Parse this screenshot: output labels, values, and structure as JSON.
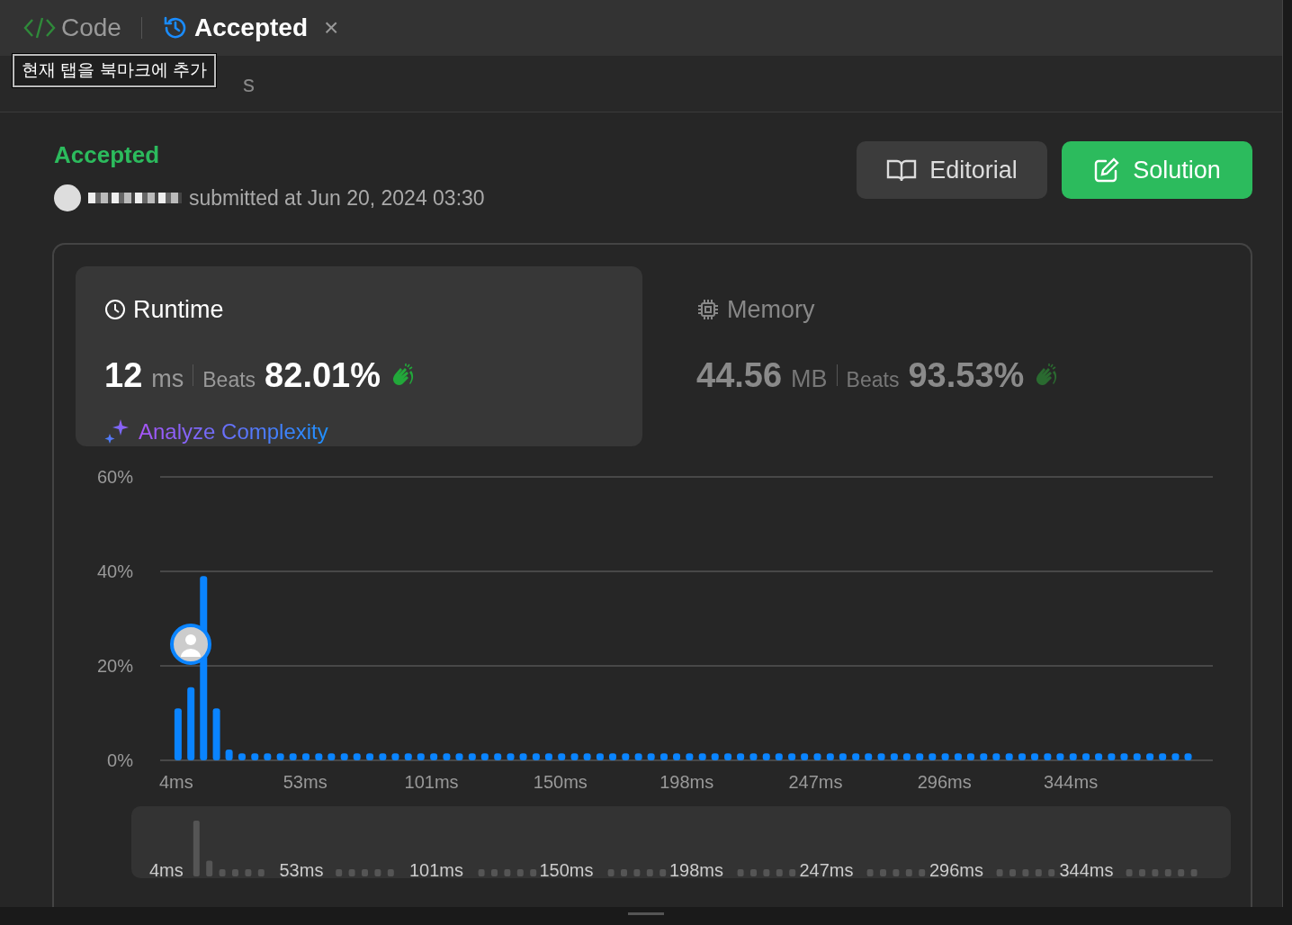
{
  "tabs": [
    {
      "kind": "code",
      "label": "Code",
      "selected": false,
      "closable": false
    },
    {
      "kind": "history",
      "label": "Accepted",
      "selected": true,
      "closable": true,
      "close_label": "×"
    }
  ],
  "tooltip": "현재 탭을 북마크에 추가",
  "back_link": "s",
  "result": {
    "status": "Accepted",
    "submitted": "submitted at Jun 20, 2024 03:30"
  },
  "actions": [
    {
      "kind": "editorial",
      "label": "Editorial"
    },
    {
      "kind": "solution",
      "label": "Solution"
    }
  ],
  "metrics": [
    {
      "kind": "runtime",
      "title": "Runtime",
      "value": "12",
      "unit": "ms",
      "beats_label": "Beats",
      "beats": "82.01%",
      "selected": true,
      "link": "Analyze Complexity"
    },
    {
      "kind": "memory",
      "title": "Memory",
      "value": "44.56",
      "unit": "MB",
      "beats_label": "Beats",
      "beats": "93.53%",
      "selected": false
    }
  ],
  "chart_data": {
    "type": "bar",
    "ylim": [
      0,
      60
    ],
    "xlim": [
      -2.8,
      397.3
    ],
    "yticks": [
      {
        "value": 0,
        "label": "0%"
      },
      {
        "value": 20,
        "label": "20%"
      },
      {
        "value": 40,
        "label": "40%"
      },
      {
        "value": 60,
        "label": "60%"
      }
    ],
    "xticks": [
      {
        "value": 4,
        "label": "4ms"
      },
      {
        "value": 53,
        "label": "53ms"
      },
      {
        "value": 101,
        "label": "101ms"
      },
      {
        "value": 150,
        "label": "150ms"
      },
      {
        "value": 198,
        "label": "198ms"
      },
      {
        "value": 247,
        "label": "247ms"
      },
      {
        "value": 296,
        "label": "296ms"
      },
      {
        "value": 344,
        "label": "344ms"
      }
    ],
    "x": [
      4,
      8.9,
      13.7,
      18.6,
      23.4,
      28.3,
      33.2,
      38,
      42.9,
      47.7,
      52.6,
      57.5,
      62.3,
      67.2,
      72,
      76.9,
      81.8,
      86.6,
      91.5,
      96.3,
      101.2,
      106.1,
      110.9,
      115.8,
      120.6,
      125.5,
      130.4,
      135.2,
      140.1,
      144.9,
      149.8,
      154.7,
      159.5,
      164.4,
      169.2,
      174.1,
      179,
      183.8,
      188.7,
      193.5,
      198.4,
      203.3,
      208.1,
      213,
      217.8,
      222.7,
      227.6,
      232.4,
      237.3,
      242.1,
      247,
      251.9,
      256.7,
      261.6,
      266.4,
      271.3,
      276.2,
      281,
      285.9,
      290.7,
      295.6,
      300.5,
      305.3,
      310.2,
      315,
      319.9,
      324.8,
      329.6,
      334.5,
      339.3,
      344.2,
      349.1,
      353.9,
      358.8,
      363.6,
      368.5,
      373.4,
      378.2,
      383.1,
      387.9
    ],
    "values": [
      11,
      15.5,
      39,
      11,
      2.3,
      1.5,
      1.5,
      1.5,
      1.5,
      1.5,
      1.5,
      1.5,
      1.5,
      1.5,
      1.5,
      1.5,
      1.5,
      1.5,
      1.5,
      1.5,
      1.5,
      1.5,
      1.5,
      1.5,
      1.5,
      1.5,
      1.5,
      1.5,
      1.5,
      1.5,
      1.5,
      1.5,
      1.5,
      1.5,
      1.5,
      1.5,
      1.5,
      1.5,
      1.5,
      1.5,
      1.5,
      1.5,
      1.5,
      1.5,
      1.5,
      1.5,
      1.5,
      1.5,
      1.5,
      1.5,
      1.5,
      1.5,
      1.5,
      1.5,
      1.5,
      1.5,
      1.5,
      1.5,
      1.5,
      1.5,
      1.5,
      1.5,
      1.5,
      1.5,
      1.5,
      1.5,
      1.5,
      1.5,
      1.5,
      1.5,
      1.5,
      1.5,
      1.5,
      1.5,
      1.5,
      1.5,
      1.5,
      1.5,
      1.5,
      1.5
    ]
  },
  "overview": {
    "xticks": [
      "4ms",
      "53ms",
      "101ms",
      "150ms",
      "198ms",
      "247ms",
      "296ms",
      "344ms"
    ]
  }
}
